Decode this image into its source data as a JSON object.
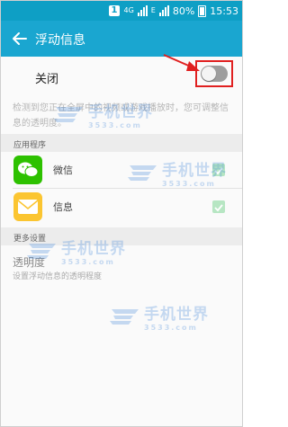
{
  "status_bar": {
    "sim_slot": "1",
    "network": "4G",
    "network_alt": "E",
    "battery": "80%",
    "time": "15:53"
  },
  "titlebar": {
    "title": "浮动信息"
  },
  "toggle": {
    "label": "关闭",
    "state": "off"
  },
  "description": "检测到您正在全屏中的视频或游戏播放时，您可调整信息的透明度。",
  "sections": {
    "apps_header": "应用程序",
    "more_header": "更多设置"
  },
  "apps": [
    {
      "label": "微信",
      "icon": "wechat-icon",
      "checked": true
    },
    {
      "label": "信息",
      "icon": "message-icon",
      "checked": true
    }
  ],
  "opacity": {
    "title": "透明度",
    "subtitle": "设置浮动信息的透明程度"
  },
  "watermark": {
    "text": "手机世界",
    "number": "3533.com"
  },
  "colors": {
    "statusbar": "#0e9fc5",
    "titlebar": "#1aa6d0",
    "highlight": "#e02020",
    "wechat": "#2dc100",
    "message": "#fbc531"
  }
}
